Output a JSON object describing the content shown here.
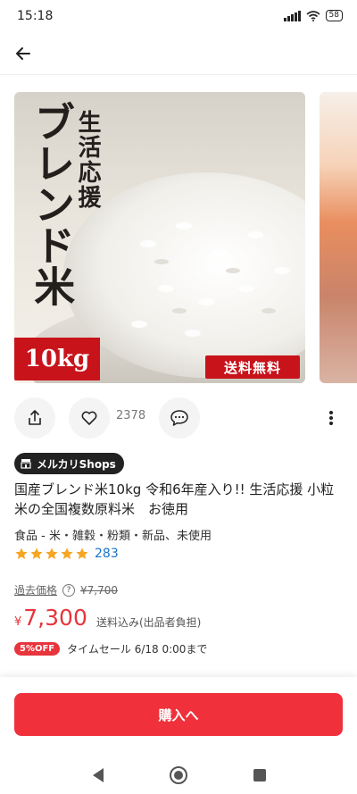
{
  "status_bar": {
    "time": "15:18",
    "battery": "58"
  },
  "gallery": {
    "image_label_small": "生活応援",
    "image_label_big": "ブレンド米",
    "image_tag_weight": "10kg",
    "image_tag_shipping": "送料無料"
  },
  "actions": {
    "like_count": "2378"
  },
  "shop_badge": "メルカリShops",
  "product": {
    "title": "国産ブレンド米10kg 令和6年産入り!! 生活応援 小粒米の全国複数原料米　お徳用",
    "category": "食品 - 米・雑穀・粉類・新品、未使用",
    "rating_stars": 5,
    "rating_count": "283"
  },
  "pricing": {
    "past_label": "過去価格",
    "help_symbol": "?",
    "past_price": "¥7,700",
    "currency": "¥",
    "price": "7,300",
    "shipping_note": "送料込み(出品者負担)",
    "discount_badge": "5%OFF",
    "sale_text": "タイムセール  6/18 0:00まで"
  },
  "buy_button": "購入へ",
  "colors": {
    "accent": "#f0313b",
    "price": "#e8343c",
    "star": "#f5a623",
    "link": "#1a73c8"
  }
}
